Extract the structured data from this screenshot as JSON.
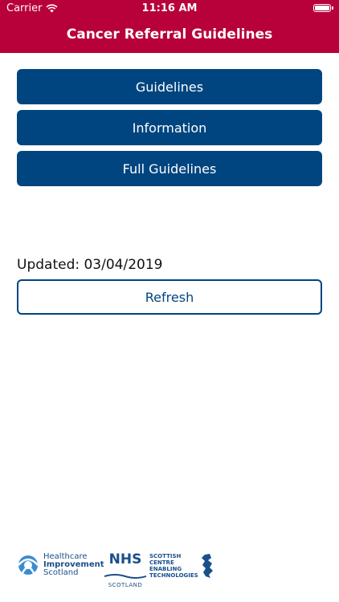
{
  "status_bar": {
    "carrier": "Carrier",
    "time": "11:16 AM"
  },
  "header": {
    "title": "Cancer Referral Guidelines"
  },
  "menu": {
    "items": [
      {
        "label": "Guidelines"
      },
      {
        "label": "Information"
      },
      {
        "label": "Full Guidelines"
      }
    ]
  },
  "update": {
    "text": "Updated: 03/04/2019",
    "refresh_label": "Refresh"
  },
  "logos": {
    "his": {
      "line1": "Healthcare",
      "line2": "Improvement",
      "line3": "Scotland"
    },
    "nhs": {
      "big": "NHS",
      "small": "SCOTLAND"
    },
    "scet": {
      "line1": "SCOTTISH",
      "line2": "CENTRE",
      "line3": "ENABLING",
      "line4": "TECHNOLOGIES"
    }
  },
  "colors": {
    "header_bg": "#b8003a",
    "button_bg": "#004580"
  }
}
